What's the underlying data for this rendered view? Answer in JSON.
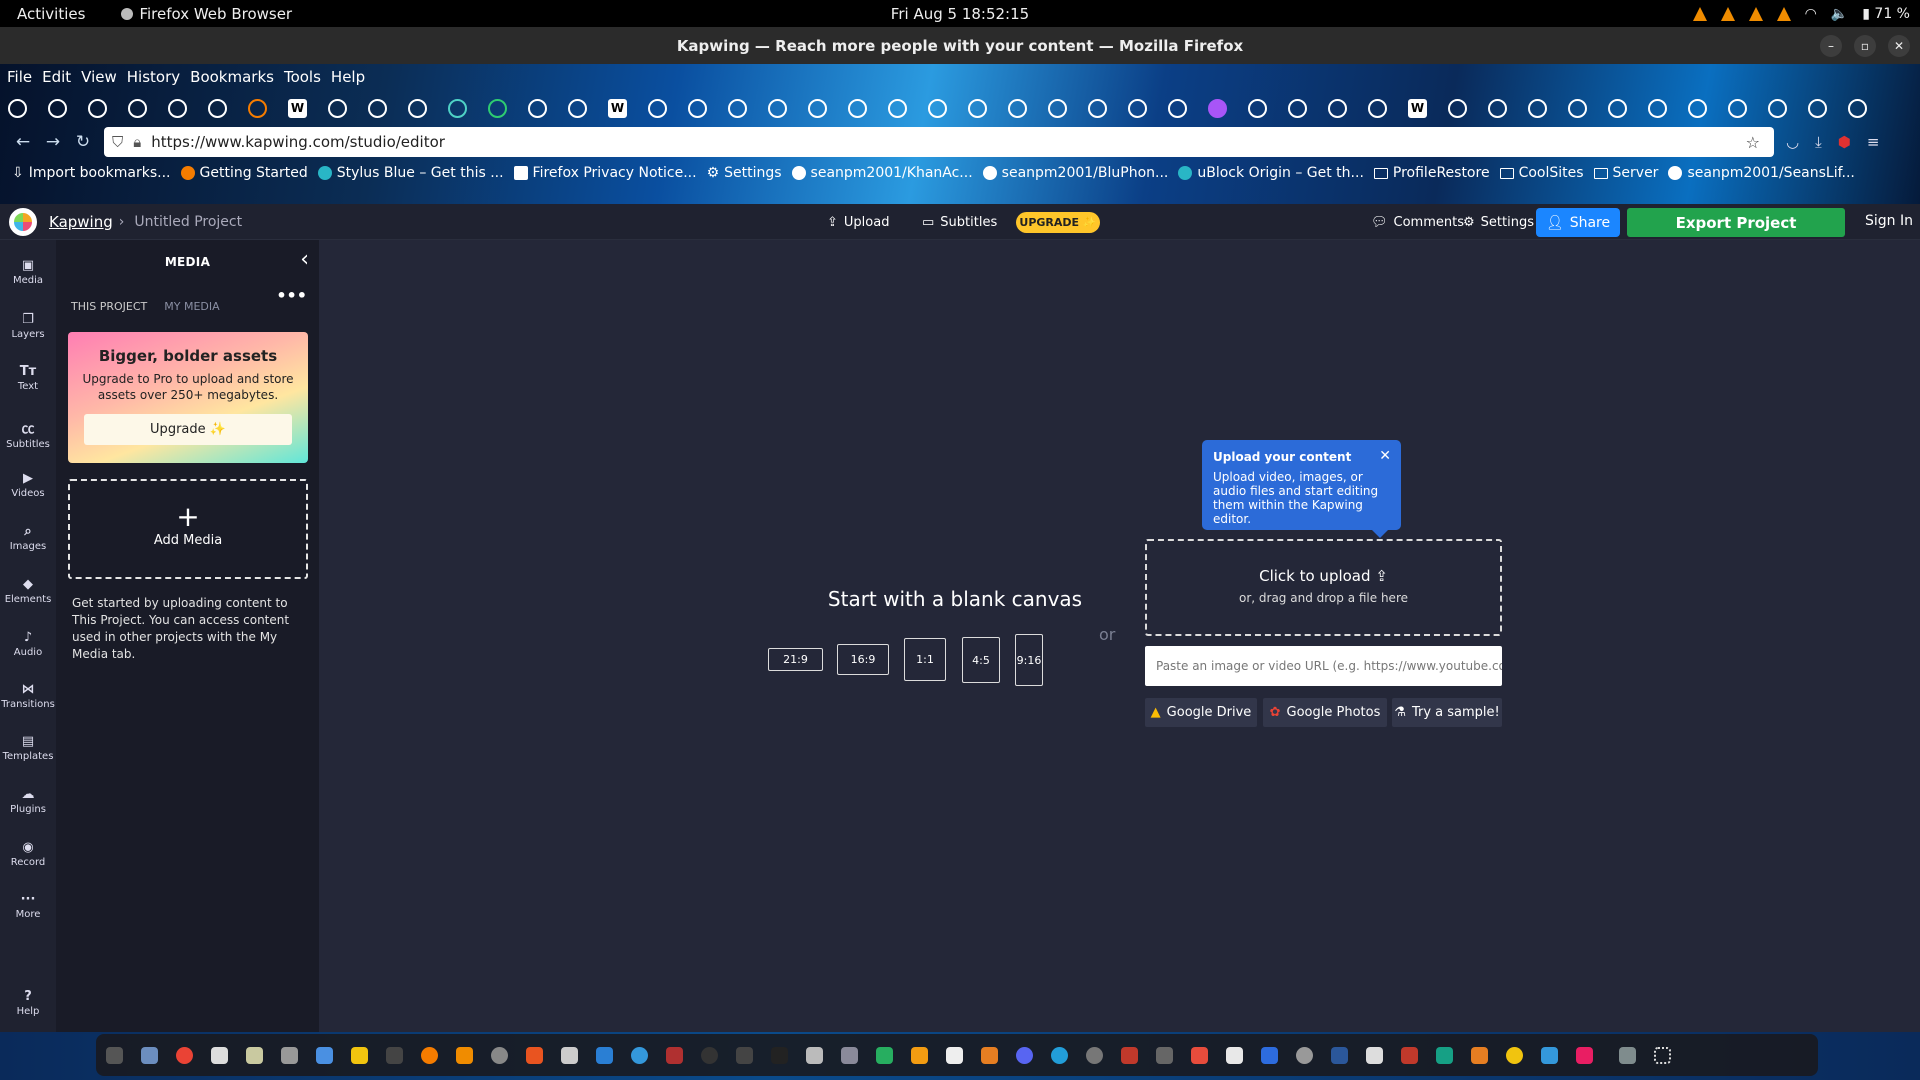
{
  "gnome": {
    "activities": "Activities",
    "app_name": "Firefox Web Browser",
    "clock": "Fri Aug 5  18:52:15",
    "battery": "71 %"
  },
  "window": {
    "title": "Kapwing — Reach more people with your content — Mozilla Firefox"
  },
  "menu": [
    "File",
    "Edit",
    "View",
    "History",
    "Bookmarks",
    "Tools",
    "Help"
  ],
  "navbar": {
    "url": "https://www.kapwing.com/studio/editor"
  },
  "bookmarks": [
    "Import bookmarks...",
    "Getting Started",
    "Stylus Blue – Get this ...",
    "Firefox Privacy Notice...",
    "Settings",
    "seanpm2001/KhanAc...",
    "seanpm2001/BluPhon...",
    "uBlock Origin – Get th...",
    "ProfileRestore",
    "CoolSites",
    "Server",
    "seanpm2001/SeansLif..."
  ],
  "kapwing": {
    "brand": "Kapwing",
    "crumb_sep": "›",
    "project_title": "Untitled Project",
    "upload": "Upload",
    "subtitles": "Subtitles",
    "upgrade_pill": "UPGRADE ✨",
    "comments": "Comments",
    "settings": "Settings",
    "share": "Share",
    "export": "Export Project",
    "sign_in": "Sign In"
  },
  "rail": [
    "Media",
    "Layers",
    "Text",
    "Subtitles",
    "Videos",
    "Images",
    "Elements",
    "Audio",
    "Transitions",
    "Templates",
    "Plugins",
    "Record",
    "More",
    "Help"
  ],
  "panel": {
    "title": "MEDIA",
    "tab_project": "THIS PROJECT",
    "tab_my_media": "MY MEDIA",
    "promo_title": "Bigger, bolder assets",
    "promo_text": "Upgrade to Pro to upload and store assets over 250+ megabytes.",
    "promo_button": "Upgrade ✨",
    "add_media": "Add Media",
    "info": "Get started by uploading content to This Project. You can access content used in other projects with the My Media tab."
  },
  "canvas": {
    "blank_title": "Start with a blank canvas",
    "ratios": [
      "21:9",
      "16:9",
      "1:1",
      "4:5",
      "9:16"
    ],
    "or": "or",
    "tooltip_title": "Upload your content",
    "tooltip_text": "Upload video, images, or audio files and start editing them within the Kapwing editor.",
    "click_upload": "Click to upload",
    "drag_drop": "or, drag and drop a file here",
    "url_placeholder": "Paste an image or video URL (e.g. https://www.youtube.com",
    "google_drive": "Google Drive",
    "google_photos": "Google Photos",
    "try_sample": "Try a sample!"
  },
  "colors": {
    "export_green": "#22a34d",
    "share_blue": "#1b86ff",
    "upgrade_yellow": "#ffc62a",
    "tooltip_blue": "#2c6bd8"
  }
}
